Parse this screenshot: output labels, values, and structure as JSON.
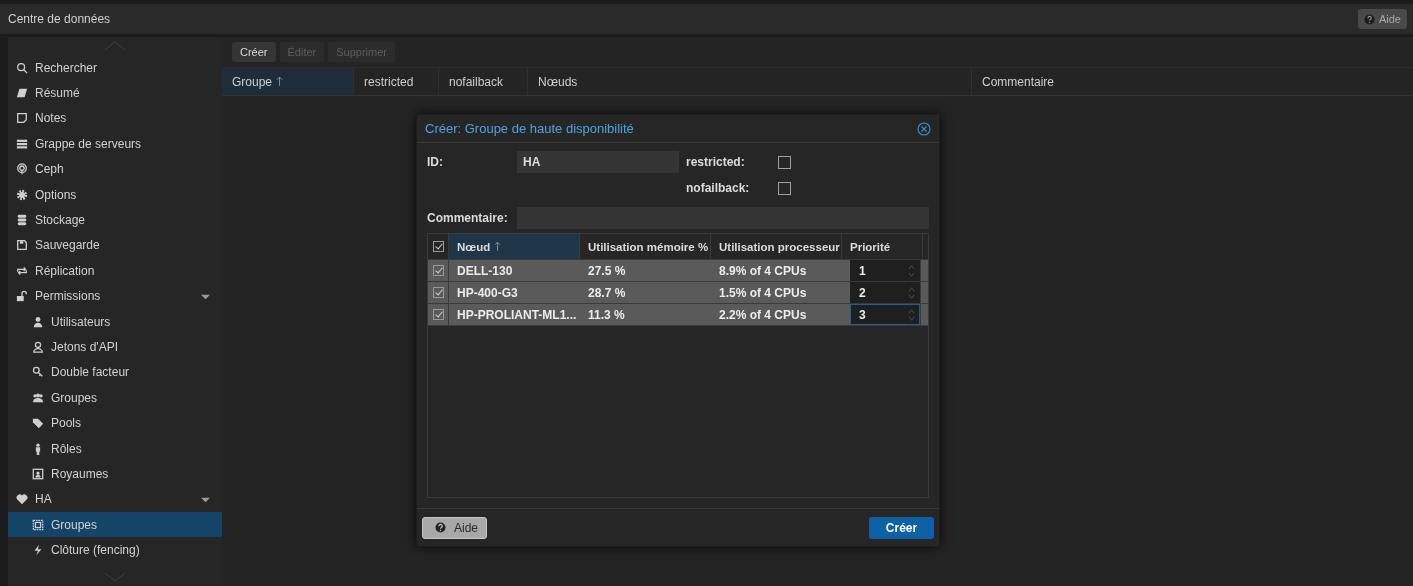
{
  "header": {
    "title": "Centre de données",
    "help_button": "Aide"
  },
  "sidebar": {
    "items": [
      {
        "label": "Rechercher",
        "selected": false
      },
      {
        "label": "Résumé",
        "selected": false
      },
      {
        "label": "Notes",
        "selected": false
      },
      {
        "label": "Grappe de serveurs",
        "selected": false
      },
      {
        "label": "Ceph",
        "selected": false
      },
      {
        "label": "Options",
        "selected": false
      },
      {
        "label": "Stockage",
        "selected": false
      },
      {
        "label": "Sauvegarde",
        "selected": false
      },
      {
        "label": "Réplication",
        "selected": false
      },
      {
        "label": "Permissions",
        "selected": false,
        "expanded": true,
        "children": [
          {
            "label": "Utilisateurs",
            "selected": false
          },
          {
            "label": "Jetons d'API",
            "selected": false
          },
          {
            "label": "Double facteur",
            "selected": false
          },
          {
            "label": "Groupes",
            "selected": false
          },
          {
            "label": "Pools",
            "selected": false
          },
          {
            "label": "Rôles",
            "selected": false
          },
          {
            "label": "Royaumes",
            "selected": false
          }
        ]
      },
      {
        "label": "HA",
        "selected": false,
        "expanded": true,
        "children": [
          {
            "label": "Groupes",
            "selected": true
          },
          {
            "label": "Clôture (fencing)",
            "selected": false
          }
        ]
      }
    ]
  },
  "toolbar": {
    "buttons": [
      {
        "label": "Créer",
        "disabled": false
      },
      {
        "label": "Éditer",
        "disabled": true
      },
      {
        "label": "Supprimer",
        "disabled": true
      }
    ]
  },
  "table": {
    "columns": [
      {
        "label": "Groupe",
        "sorted": true
      },
      {
        "label": "restricted",
        "sorted": false
      },
      {
        "label": "nofailback",
        "sorted": false
      },
      {
        "label": "Nœuds",
        "sorted": false
      },
      {
        "label": "Commentaire",
        "sorted": false
      }
    ]
  },
  "dialog": {
    "title": "Créer: Groupe de haute disponibilité",
    "id": {
      "label": "ID:",
      "value": "HA"
    },
    "restricted": {
      "label": "restricted:",
      "checked": false
    },
    "nofailback": {
      "label": "nofailback:",
      "checked": false
    },
    "comment": {
      "label": "Commentaire:"
    },
    "grid": {
      "all_checked": true,
      "columns": [
        {
          "label": "Nœud",
          "sorted": true
        },
        {
          "label": "Utilisation mémoire %",
          "sorted": false
        },
        {
          "label": "Utilisation processeur",
          "sorted": false
        },
        {
          "label": "Priorité",
          "sorted": false
        }
      ],
      "rows": [
        {
          "checked": true,
          "node": "DELL-130",
          "memory": "27.5 %",
          "cpu": "8.9% of 4 CPUs",
          "priority": "1",
          "focused": false
        },
        {
          "checked": true,
          "node": "HP-400-G3",
          "memory": "28.7 %",
          "cpu": "1.5% of 4 CPUs",
          "priority": "2",
          "focused": false
        },
        {
          "checked": true,
          "node": "HP-PROLIANT-ML1...",
          "memory": "11.3 %",
          "cpu": "2.2% of 4 CPUs",
          "priority": "3",
          "focused": true
        }
      ]
    },
    "help_button": "Aide",
    "create_button": "Créer"
  }
}
